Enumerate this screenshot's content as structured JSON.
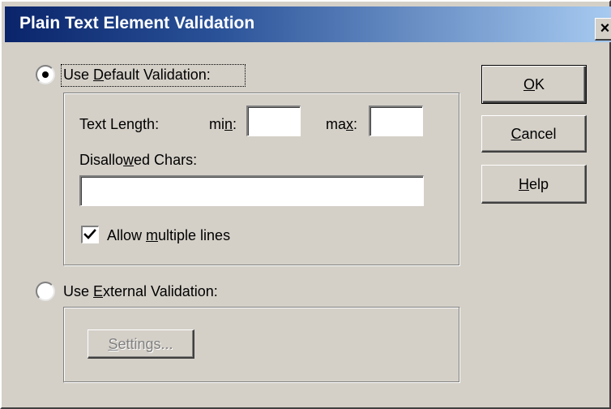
{
  "dialog": {
    "title": "Plain Text Element Validation",
    "close_glyph": "×"
  },
  "default_validation": {
    "selected": true,
    "label_pre": "Use ",
    "label_accel": "D",
    "label_post": "efault Validation:",
    "text_length_label": "Text Length:",
    "min_label_pre": "mi",
    "min_label_accel": "n",
    "min_label_post": ":",
    "min_value": "",
    "max_label_pre": "ma",
    "max_label_accel": "x",
    "max_label_post": ":",
    "max_value": "",
    "disallowed_label_pre": "Disallo",
    "disallowed_label_accel": "w",
    "disallowed_label_post": "ed Chars:",
    "disallowed_value": "",
    "multiline_checked": true,
    "multiline_label_pre": "Allow ",
    "multiline_label_accel": "m",
    "multiline_label_post": "ultiple lines"
  },
  "external_validation": {
    "selected": false,
    "label_pre": "Use ",
    "label_accel": "E",
    "label_post": "xternal Validation:",
    "settings_accel": "S",
    "settings_rest": "ettings..."
  },
  "buttons": {
    "ok_accel": "O",
    "ok_rest": "K",
    "cancel_accel": "C",
    "cancel_rest": "ancel",
    "help_accel": "H",
    "help_rest": "elp"
  },
  "colors": {
    "face": "#d4d0c8",
    "title_start": "#0a246a",
    "title_end": "#a6caf0",
    "disabled_text": "#808080"
  },
  "icons": {
    "close": "close-icon",
    "check": "checkmark-icon",
    "radio_dot": "radio-dot-icon"
  }
}
